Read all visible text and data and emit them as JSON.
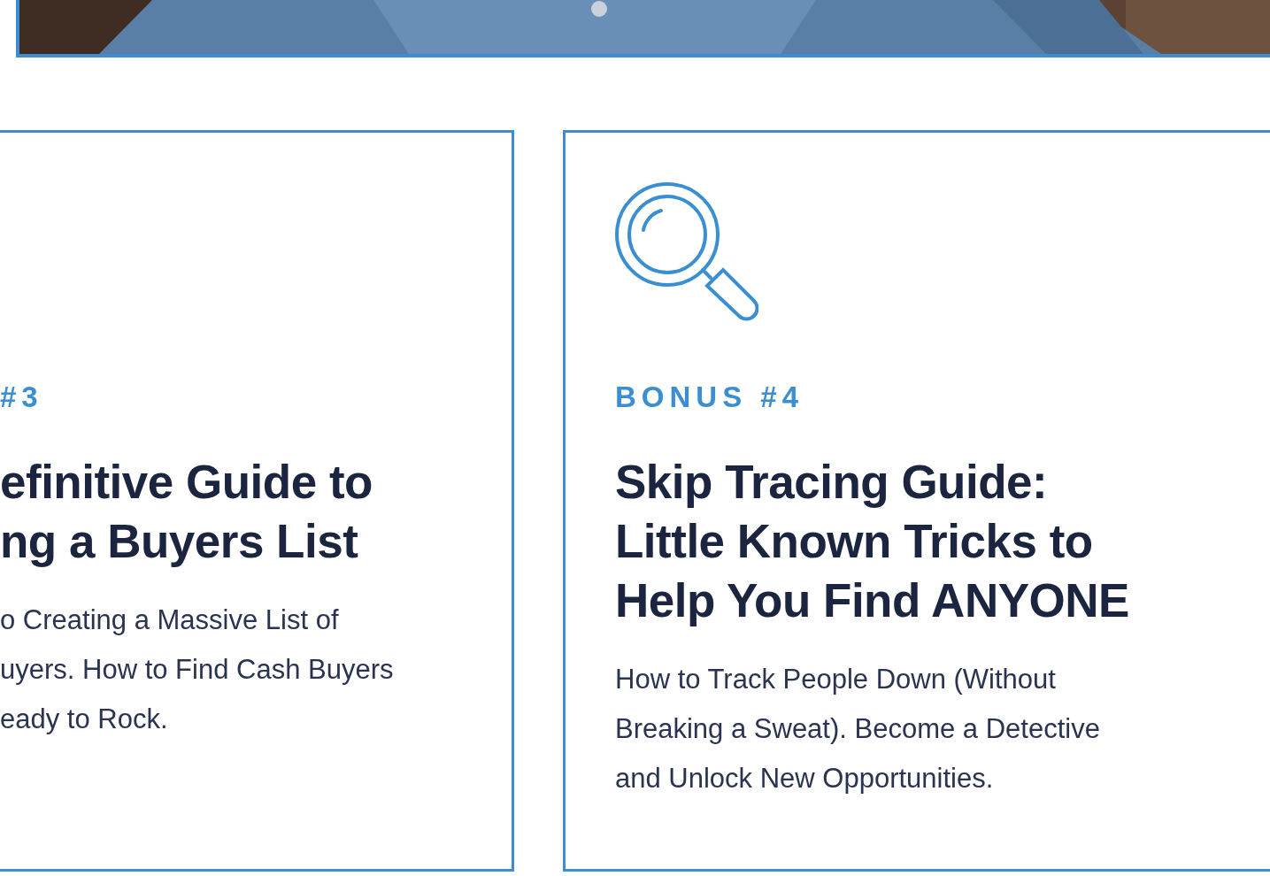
{
  "cards": [
    {
      "label": "#3",
      "title_lines": [
        "efinitive Guide to",
        "ng a Buyers List"
      ],
      "description_lines": [
        "o Creating a Massive List of",
        "uyers. How to Find Cash Buyers",
        "eady to Rock."
      ],
      "kind": "cut"
    },
    {
      "label": "BONUS #4",
      "title_lines": [
        "Skip Tracing Guide:",
        "Little Known Tricks to",
        "Help You Find ANYONE"
      ],
      "description_lines": [
        "How to Track People Down (Without",
        "Breaking a Sweat). Become a Detective",
        "and Unlock New Opportunities."
      ],
      "kind": "full"
    }
  ]
}
